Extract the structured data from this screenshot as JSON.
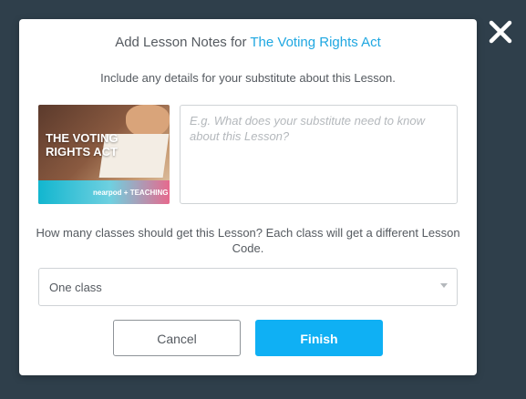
{
  "modal": {
    "title_prefix": "Add Lesson Notes for",
    "lesson_title": "The Voting Rights Act",
    "subtitle": "Include any details for your substitute about this Lesson."
  },
  "thumbnail": {
    "title": "THE VOTING RIGHTS ACT",
    "logo_nearpod": "nearpod",
    "logo_partner": "TEACHING TOLERANCE"
  },
  "notes": {
    "placeholder": "E.g. What does your substitute need to know about this Lesson?",
    "value": ""
  },
  "classes": {
    "question": "How many classes should get this Lesson? Each class will get a different Lesson Code.",
    "selected": "One class"
  },
  "buttons": {
    "cancel": "Cancel",
    "finish": "Finish"
  },
  "icons": {
    "close": "close-icon",
    "dropdown": "chevron-down-icon"
  },
  "colors": {
    "accent": "#0fb0f4",
    "link": "#1fa7e1",
    "backdrop": "#2f3f4b"
  }
}
